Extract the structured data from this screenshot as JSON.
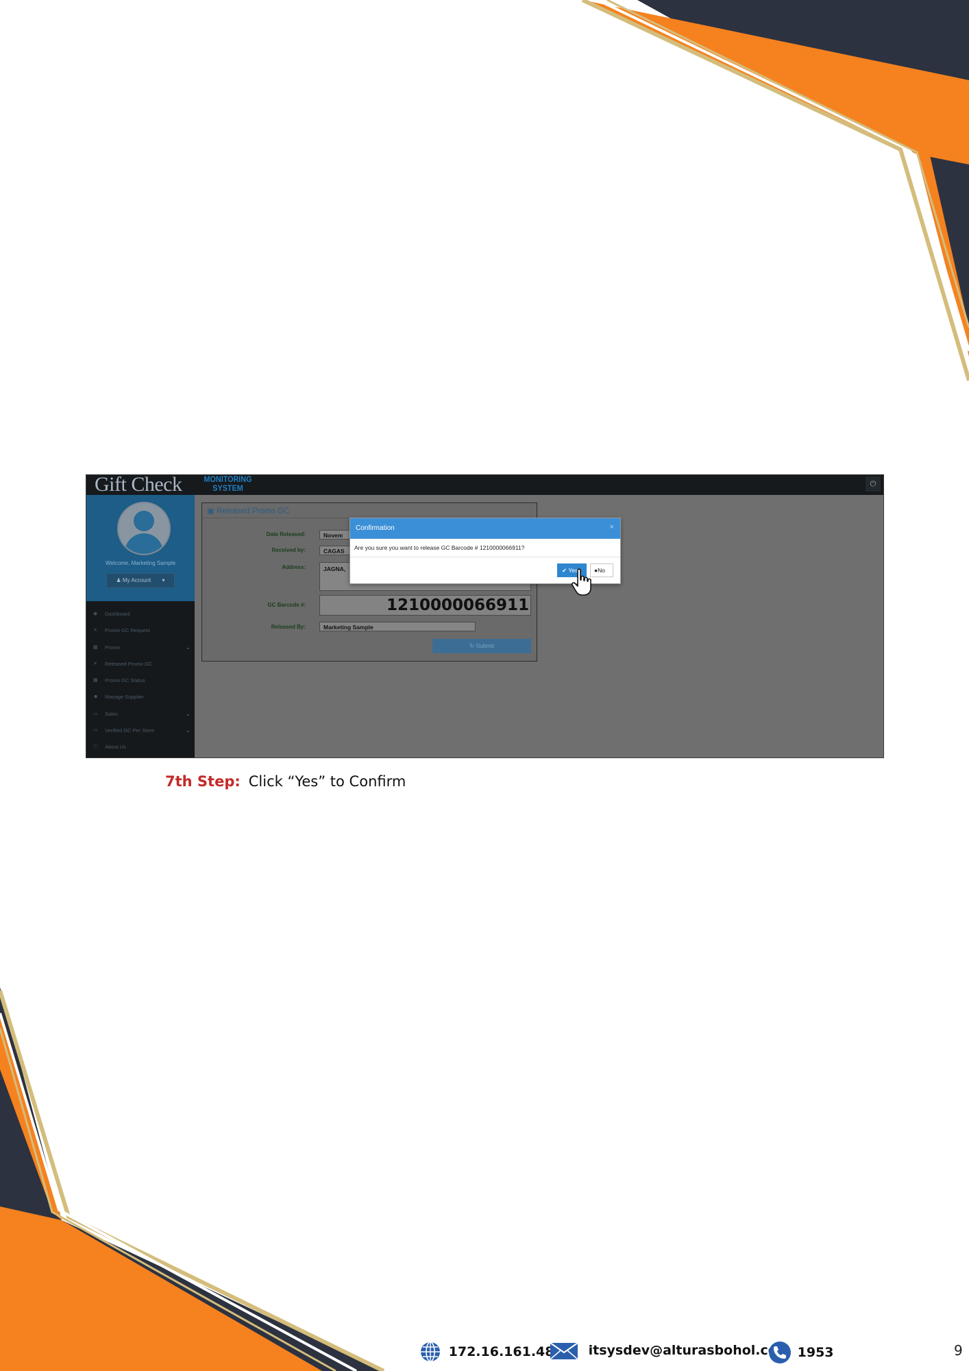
{
  "colors": {
    "accent_orange": "#f5821f",
    "navy": "#2d3240",
    "gold": "#d4bd7c",
    "step_red": "#c42a2a",
    "app_blue": "#3b8fd6"
  },
  "app": {
    "logo_text": "Gift Check",
    "logo_subtitle_line1": "MONITORING",
    "logo_subtitle_line2": "SYSTEM",
    "power_icon": "power-icon",
    "welcome": "Welcome, Marketing Sample",
    "account_label": "My Account",
    "menu": [
      {
        "label": "Dashboard",
        "icon": "dashboard-icon",
        "has_submenu": false
      },
      {
        "label": "Promo GC Request",
        "icon": "shuffle-icon",
        "has_submenu": false
      },
      {
        "label": "Promo",
        "icon": "grid-icon",
        "has_submenu": true
      },
      {
        "label": "Released Promo GC",
        "icon": "shuffle-icon",
        "has_submenu": false
      },
      {
        "label": "Promo GC Status",
        "icon": "grid-icon",
        "has_submenu": false
      },
      {
        "label": "Manage Supplier",
        "icon": "users-icon",
        "has_submenu": false
      },
      {
        "label": "Sales",
        "icon": "monitor-icon",
        "has_submenu": true
      },
      {
        "label": "Verified GC Per Store",
        "icon": "monitor-icon",
        "has_submenu": true
      },
      {
        "label": "About Us",
        "icon": "info-icon",
        "has_submenu": false
      }
    ],
    "form": {
      "title": "Released Promo GC",
      "date_released_label": "Date Released:",
      "date_released_value": "Novem",
      "received_by_label": "Received by:",
      "received_by_value": "CAGAS",
      "address_label": "Address:",
      "address_value": "JAGNA,",
      "barcode_label": "GC Barcode #:",
      "barcode_value": "1210000066911",
      "released_by_label": "Released By:",
      "released_by_value": "Marketing Sample",
      "submit_label": "Submit"
    },
    "dialog": {
      "title": "Confirmation",
      "close": "×",
      "message": "Are you sure you want to release GC Barcode # 1210000066911?",
      "yes_label": "Yes",
      "no_label": "No"
    }
  },
  "instruction": {
    "step_label": "7th Step:",
    "step_text": "Click “Yes” to Confirm"
  },
  "footer": {
    "ip": "172.16.161.48",
    "email": "itsysdev@alturasbohol.com",
    "phone": "1953",
    "page_number": "9"
  }
}
